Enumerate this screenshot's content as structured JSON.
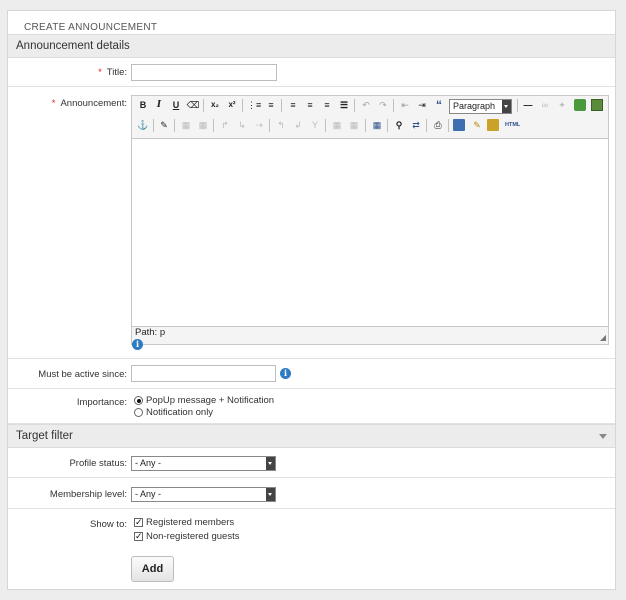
{
  "panel": {
    "title": "CREATE ANNOUNCEMENT"
  },
  "sections": {
    "details": "Announcement details",
    "target": "Target filter"
  },
  "form": {
    "title_label": "Title:",
    "title_value": "",
    "announcement_label": "Announcement:",
    "editor": {
      "format_select": "Paragraph",
      "path_label": "Path: p",
      "toolbar_row1": [
        "bold-icon",
        "italic-icon",
        "underline-icon",
        "strikethrough-icon",
        "subscript-icon",
        "superscript-icon",
        "bullet-list-icon",
        "numbered-list-icon",
        "align-left-icon",
        "align-center-icon",
        "align-right-icon",
        "align-justify-icon",
        "undo-icon",
        "redo-icon",
        "outdent-icon",
        "indent-icon",
        "blockquote-icon",
        "horizontal-rule-icon",
        "link-icon",
        "unlink-icon",
        "image-icon",
        "media-icon"
      ],
      "toolbar_row2": [
        "anchor-icon",
        "edit-icon",
        "table-icon",
        "cell-props-icon",
        "row-before-icon",
        "row-after-icon",
        "delete-row-icon",
        "col-before-icon",
        "col-after-icon",
        "delete-col-icon",
        "split-cells-icon",
        "merge-cells-icon",
        "insert-table-icon",
        "search-icon",
        "replace-icon",
        "print-icon",
        "preview-icon",
        "cleanup-icon",
        "paste-icon",
        "html-icon"
      ]
    },
    "active_since_label": "Must be active since:",
    "active_since_value": "",
    "importance_label": "Importance:",
    "importance_options": [
      "PopUp message + Notification",
      "Notification only"
    ],
    "importance_selected": 0,
    "profile_status_label": "Profile status:",
    "profile_status_value": "- Any -",
    "membership_label": "Membership level:",
    "membership_value": "- Any -",
    "show_to_label": "Show to:",
    "show_to_options": [
      {
        "label": "Registered members",
        "checked": true
      },
      {
        "label": "Non-registered guests",
        "checked": true
      }
    ],
    "add_button": "Add"
  },
  "colors": {
    "required": "#dd2222",
    "info": "#2e7bc4",
    "section_bg": "#ececec"
  },
  "icons": {
    "info": "info-icon",
    "collapse": "chevron-down-icon",
    "resize": "resize-handle-icon"
  }
}
